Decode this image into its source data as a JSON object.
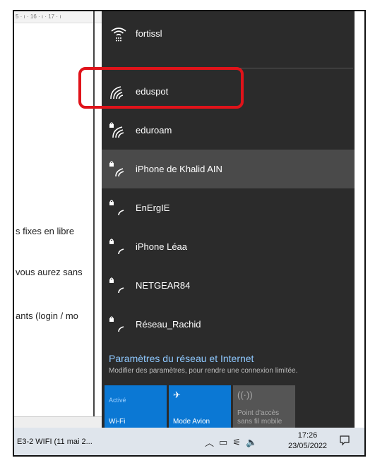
{
  "document": {
    "ruler_text": "5 · ı · 16 · ı · 17 · ı",
    "lines": [
      "s fixes en libre",
      "vous aurez sans",
      "ants (login / mo"
    ]
  },
  "networks": {
    "top": {
      "name": "fortissl",
      "icon": "wifi-connected-icon"
    },
    "items": [
      {
        "name": "eduspot",
        "icon": "wifi-open-icon",
        "secured": false
      },
      {
        "name": "eduroam",
        "icon": "wifi-secured-icon",
        "secured": true
      },
      {
        "name": "iPhone de Khalid AIN",
        "icon": "wifi-secured-icon",
        "secured": true
      },
      {
        "name": "EnErgIE",
        "icon": "wifi-secured-icon",
        "secured": true
      },
      {
        "name": "iPhone Léaa",
        "icon": "wifi-secured-icon",
        "secured": true
      },
      {
        "name": "NETGEAR84",
        "icon": "wifi-secured-icon",
        "secured": true
      },
      {
        "name": "Réseau_Rachid",
        "icon": "wifi-secured-icon",
        "secured": true
      }
    ]
  },
  "settings": {
    "title": "Paramètres du réseau et Internet",
    "subtitle": "Modifier des paramètres, pour rendre une connexion limitée."
  },
  "quick_actions": [
    {
      "state": "Activé",
      "label": "Wi-Fi",
      "active": true
    },
    {
      "state": "",
      "label": "Mode Avion",
      "active": true,
      "icon": "airplane-icon"
    },
    {
      "state": "",
      "label": "Point d'accès\nsans fil mobile",
      "active": false,
      "icon": "hotspot-icon"
    }
  ],
  "taskbar": {
    "app_title": "E3-2 WIFI (11 mai 2...",
    "time": "17:26",
    "date": "23/05/2022",
    "tray_icons": [
      "chevron-up-icon",
      "battery-icon",
      "network-icon",
      "volume-icon"
    ]
  },
  "colors": {
    "flyout_bg": "#2b2b2b",
    "hover_bg": "#4a4a4a",
    "accent": "#0b78d4",
    "link": "#8ec8ff",
    "highlight": "#e0131a"
  }
}
